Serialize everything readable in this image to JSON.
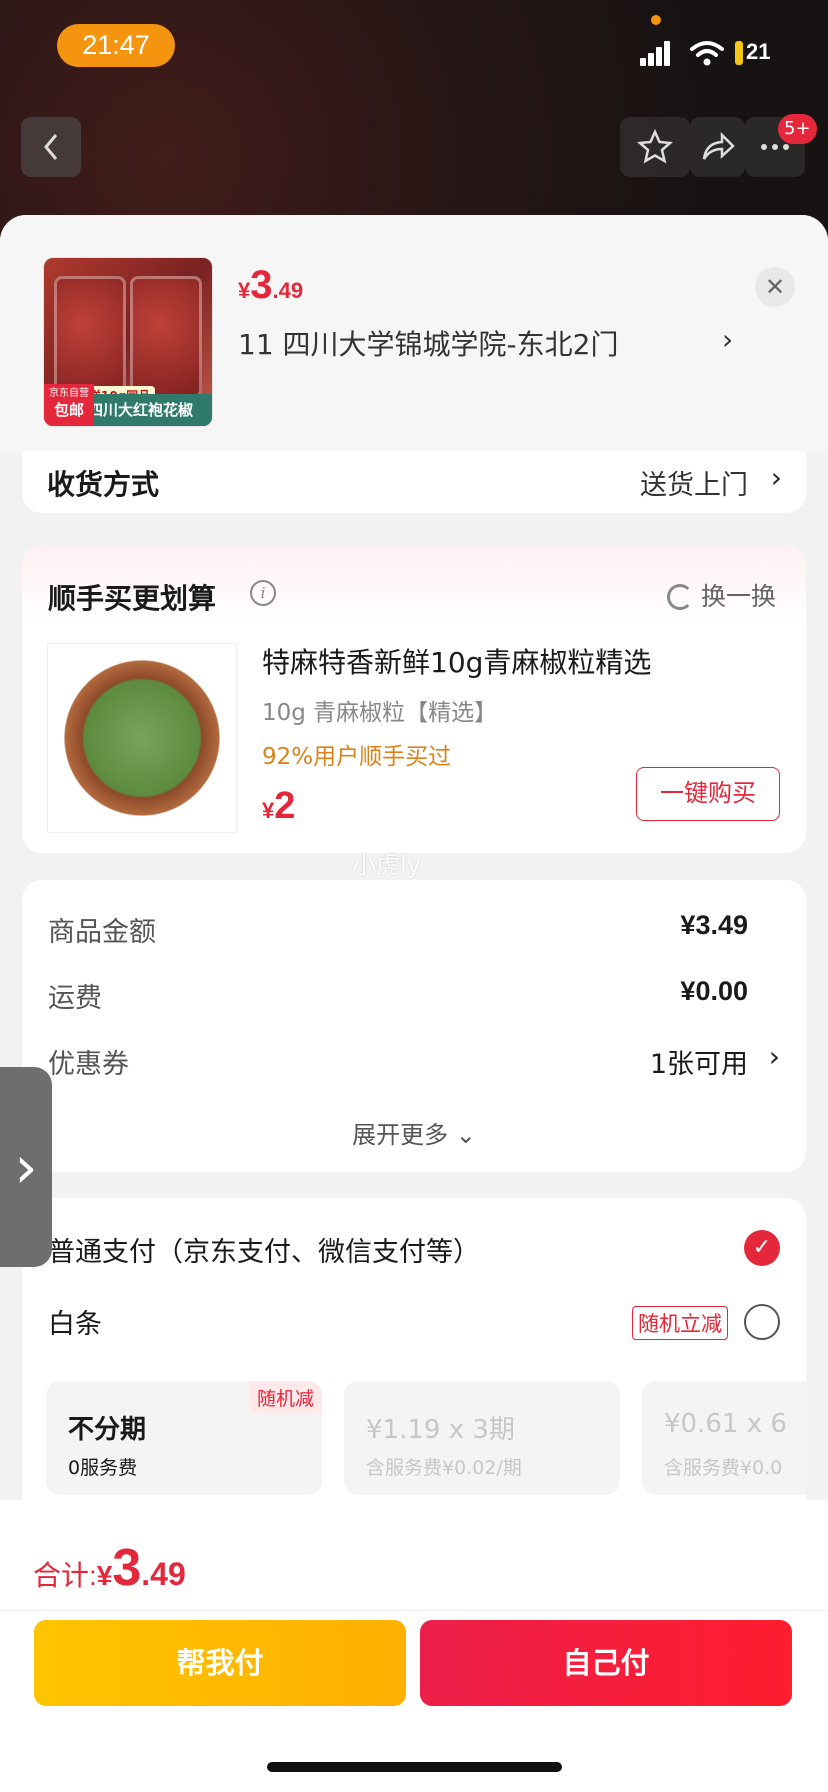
{
  "status_bar": {
    "time": "21:47",
    "battery": "21"
  },
  "nav": {
    "badge": "5+"
  },
  "header": {
    "price": {
      "currency": "¥",
      "integer": "3",
      "decimal": ".49"
    },
    "address": "11  四川大学锦城学院-东北2门",
    "product_image": {
      "tag": "送10g同品",
      "band_text": "四川大红袍花椒",
      "corner_top": "京东自营",
      "corner_bottom": "包邮"
    }
  },
  "delivery": {
    "label": "收货方式",
    "value": "送货上门"
  },
  "upsell": {
    "title": "顺手买更划算",
    "swap_label": "换一换",
    "product_name": "特麻特香新鲜10g青麻椒粒精选",
    "spec": "10g 青麻椒粒【精选】",
    "stat": "92%用户顺手买过",
    "price": {
      "currency": "¥",
      "integer": "2"
    },
    "buy_label": "一键购买"
  },
  "watermark": "小虎ly",
  "summary": {
    "rows": [
      {
        "label": "商品金额",
        "value": "¥3.49"
      },
      {
        "label": "运费",
        "value": "¥0.00"
      },
      {
        "label": "优惠券",
        "value": "1张可用"
      }
    ],
    "more_label": "展开更多"
  },
  "payment": {
    "normal_label": "普通支付（京东支付、微信支付等）",
    "baitiao_label": "白条",
    "random_tag": "随机立减",
    "installments": [
      {
        "title": "不分期",
        "sub": "0服务费",
        "corner": "随机减"
      },
      {
        "title": "¥1.19 x 3期",
        "sub": "含服务费¥0.02/期"
      },
      {
        "title": "¥0.61 x 6",
        "sub": "含服务费¥0.0"
      }
    ]
  },
  "footer": {
    "total_label": "合计:",
    "total": {
      "currency": "¥",
      "integer": "3",
      "decimal": ".49"
    },
    "help_pay_label": "帮我付",
    "self_pay_label": "自己付"
  },
  "colors": {
    "accent": "#e4273a",
    "help_button": "#ffc400",
    "self_button": "#ff1d2e",
    "time_pill": "#f5940f"
  }
}
